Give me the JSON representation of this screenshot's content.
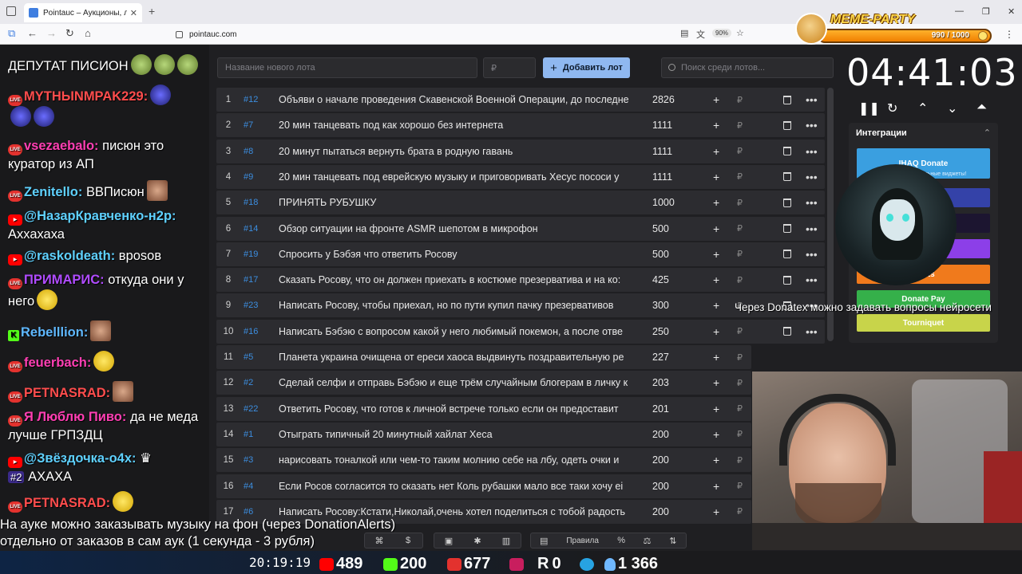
{
  "browser": {
    "tab_title": "Pointauc – Аукционы, лотере",
    "url": "pointauc.com",
    "zoom": "90%"
  },
  "meme_party": {
    "title": "MEME-PARTY",
    "progress_text": "990 / 1000",
    "progress": 0.99
  },
  "chat": {
    "lines": [
      {
        "nick": "",
        "text": "ДЕПУТАТ ПИСИОН"
      },
      {
        "nick": "MYTHЫNMPAK229:",
        "text": ""
      },
      {
        "nick": "vsezaebalo:",
        "text": "писюн это куратор из АП"
      },
      {
        "nick": "Zenitello:",
        "text": "ВВПисюн"
      },
      {
        "nick": "@НазарКравченко-н2р:",
        "text": "Аххахаха"
      },
      {
        "nick": "@raskoldeath:",
        "text": "врosов"
      },
      {
        "nick": "ПРИМАРИС:",
        "text": "откуда они у него"
      },
      {
        "nick": "Rebelllion:",
        "text": ""
      },
      {
        "nick": "feuerbach:",
        "text": ""
      },
      {
        "nick": "PETNASRAD:",
        "text": ""
      },
      {
        "nick": "Я Люблю Пиво:",
        "text": "да не меда лучше ГРПЗДЦ"
      },
      {
        "nick": "@Звёздочка-о4х:",
        "text": "АХАХА"
      },
      {
        "nick": "PETNASRAD:",
        "text": ""
      }
    ],
    "rank_badge": "#2"
  },
  "topbar": {
    "lot_placeholder": "Название нового лота",
    "price_placeholder": "₽",
    "add_button": "Добавить лот",
    "search_placeholder": "Поиск среди лотов..."
  },
  "lots": [
    {
      "n": "1",
      "id": "#12",
      "name": "Объяви о начале проведения Скавенской Военной Операции, до последне",
      "amount": "2826"
    },
    {
      "n": "2",
      "id": "#7",
      "name": "20 мин танцевать под как хорошо без интернета",
      "amount": "1111"
    },
    {
      "n": "3",
      "id": "#8",
      "name": "20 минут пытаться вернуть брата в родную гавань",
      "amount": "1111"
    },
    {
      "n": "4",
      "id": "#9",
      "name": "20 мин танцевать под еврейскую музыку и приговоривать Хесус пососи у",
      "amount": "1111"
    },
    {
      "n": "5",
      "id": "#18",
      "name": "ПРИНЯТЬ РУБУШКУ",
      "amount": "1000"
    },
    {
      "n": "6",
      "id": "#14",
      "name": "Обзор ситуации на фронте ASMR шепотом в микрофон",
      "amount": "500"
    },
    {
      "n": "7",
      "id": "#19",
      "name": "Спросить у Бэбэя что ответить Росову",
      "amount": "500"
    },
    {
      "n": "8",
      "id": "#17",
      "name": "Сказать Росову, что он должен приехать в костюме презерватива и на ко:",
      "amount": "425"
    },
    {
      "n": "9",
      "id": "#23",
      "name": "Написать Росову, чтобы приехал, но по пути купил пачку презервативов",
      "amount": "300"
    },
    {
      "n": "10",
      "id": "#16",
      "name": "Написать Бэбэю с вопросом какой у него любимый покемон, а после отве",
      "amount": "250"
    },
    {
      "n": "11",
      "id": "#5",
      "name": "Планета украина очищена от ереси хаоса выдвинуть поздравительную ре",
      "amount": "227"
    },
    {
      "n": "12",
      "id": "#2",
      "name": "Сделай селфи и отправь Бэбэю и еще трём случайным блогерам в личку к",
      "amount": "203"
    },
    {
      "n": "13",
      "id": "#22",
      "name": "Ответить Росову, что готов к личной встрече только если он предоставит",
      "amount": "201"
    },
    {
      "n": "14",
      "id": "#1",
      "name": "Отыграть типичный 20 минутный хайлат Хеса",
      "amount": "200"
    },
    {
      "n": "15",
      "id": "#3",
      "name": "нарисовать тоналкой или чем-то таким молнию себе на лбу, одеть очки и",
      "amount": "200"
    },
    {
      "n": "16",
      "id": "#4",
      "name": "Если Росов согласится то сказать нет Коль рубашки мало все таки хочу еі",
      "amount": "200"
    },
    {
      "n": "17",
      "id": "#6",
      "name": "Написать Росову:Кстати,Николай,очень хотел поделиться с тобой радость",
      "amount": "200"
    }
  ],
  "timer": {
    "value": "04:41:03"
  },
  "integrations": {
    "title": "Интеграции",
    "buttons": [
      {
        "label": "IHAQ Donate",
        "sub": "Коллекция уникальные виджеты!",
        "color": "#3a9fe0"
      },
      {
        "label": "er",
        "sub": "",
        "color": "#3442a8"
      },
      {
        "label": "",
        "sub": "",
        "color": "#1c1530"
      },
      {
        "label": "",
        "sub": "",
        "color": "#8c3fe8"
      },
      {
        "label": "Alerts",
        "sub": "",
        "color": "#f07a1c"
      },
      {
        "label": "Donate Pay",
        "sub": "",
        "color": "#35b04a"
      },
      {
        "label": "Tourniquet",
        "sub": "",
        "color": "#c8d44a"
      }
    ]
  },
  "marquee": "Через Donatex можно задавать вопросы нейросети",
  "bottom": {
    "caption_line1": "На ауке можно заказывать музыку на фон (через DonationAlerts)",
    "caption_line2": "отдельно от заказов в сам аук (1 секунда - 3 рубля)",
    "rules_label": "Правила",
    "clock": "20:19:19",
    "stats": {
      "youtube": "489",
      "kick": "200",
      "live": "677",
      "rumble": "0",
      "telegram": "1 366"
    }
  }
}
